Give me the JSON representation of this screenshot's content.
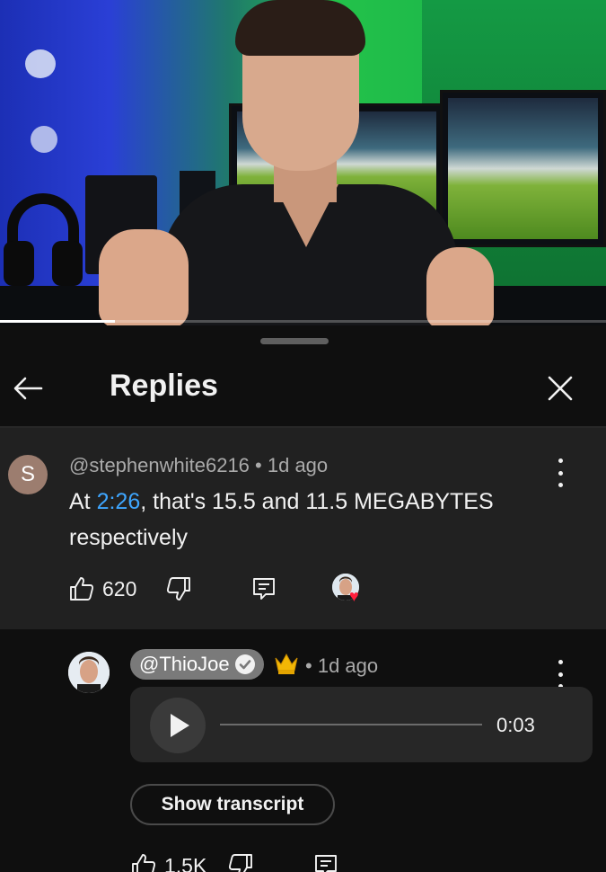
{
  "video": {
    "progress_fraction": 0.19
  },
  "sheet": {
    "title": "Replies",
    "back_icon": "arrow-left-icon",
    "close_icon": "close-icon"
  },
  "comment": {
    "avatar_letter": "S",
    "author": "@stephenwhite6216",
    "separator": " • ",
    "age": "1d ago",
    "text_prefix": "At ",
    "timestamp": "2:26",
    "text_suffix": ", that's 15.5 and 11.5 MEGABYTES respectively",
    "like_count": "620",
    "icons": [
      "thumb-up-icon",
      "thumb-down-icon",
      "reply-icon",
      "creator-heart-icon",
      "more-vert-icon"
    ]
  },
  "reply": {
    "author": "@ThioJoe",
    "verified": true,
    "badge_icon": "crown-icon",
    "separator": " • ",
    "age": "1d ago",
    "audio": {
      "duration": "0:03",
      "progress_fraction": 0
    },
    "transcript_label": "Show transcript",
    "like_count": "1.5K",
    "icons": [
      "thumb-up-icon",
      "thumb-down-icon",
      "reply-icon",
      "more-vert-icon",
      "play-icon"
    ]
  },
  "colors": {
    "background": "#0f0f0f",
    "comment_background": "#212121",
    "timestamp_link": "#3ea6ff",
    "heart": "#ff1f3d",
    "crown": "#f2b705"
  }
}
